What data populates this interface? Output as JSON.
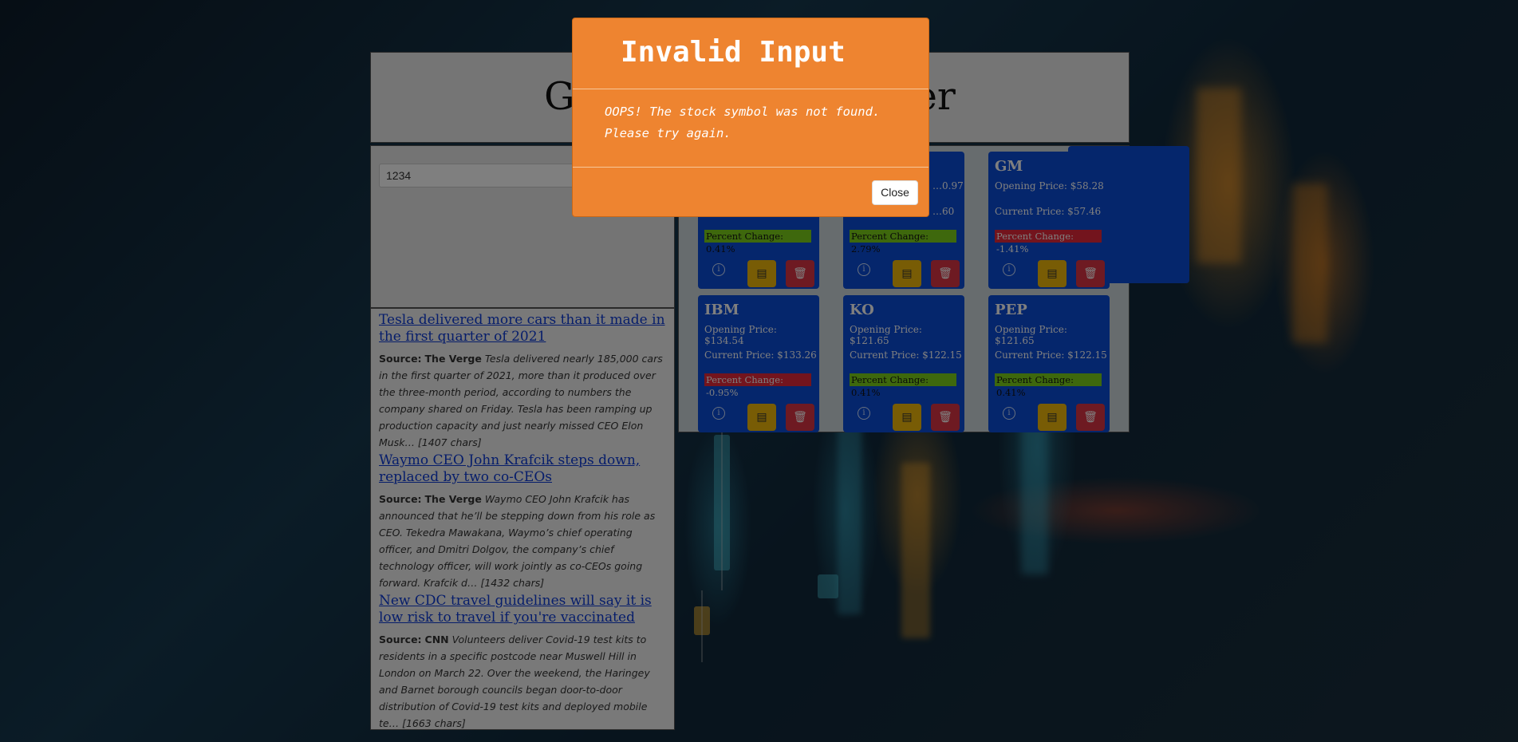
{
  "header": {
    "title": "Global Stock Tracker"
  },
  "search": {
    "value": "1234"
  },
  "news": [
    {
      "title": "Tesla delivered more cars than it made in the first quarter of 2021",
      "source_label": "Source:",
      "source": "The Verge",
      "text": "Tesla delivered nearly 185,000 cars in the first quarter of 2021, more than it produced over the three-month period, according to numbers the company shared on Friday. Tesla has been ramping up production capacity and just nearly missed CEO Elon Musk… [1407 chars]"
    },
    {
      "title": "Waymo CEO John Krafcik steps down, replaced by two co-CEOs",
      "source_label": "Source:",
      "source": "The Verge",
      "text": "Waymo CEO John Krafcik has announced that he’ll be stepping down from his role as CEO. Tekedra Mawakana, Waymo’s chief operating officer, and Dmitri Dolgov, the company’s chief technology officer, will work jointly as co-CEOs going forward. Krafcik d… [1432 chars]"
    },
    {
      "title": "New CDC travel guidelines will say it is low risk to travel if you're vaccinated",
      "source_label": "Source:",
      "source": "CNN",
      "text": "Volunteers deliver Covid-19 test kits to residents in a specific postcode near Muswell Hill in London on March 22. Over the weekend, the Haringey and Barnet borough councils began door-to-door distribution of Covid-19 test kits and deployed mobile te… [1663 chars]"
    }
  ],
  "cards": [
    {
      "symbol": "",
      "open": "",
      "current": "",
      "percent": "Percent Change: 0.41%",
      "trend": "up"
    },
    {
      "symbol": "",
      "open": "…0.97",
      "current": "…60",
      "percent": "Percent Change: 2.79%",
      "trend": "up"
    },
    {
      "symbol": "GM",
      "open": "Opening Price: $58.28",
      "current": "Current Price: $57.46",
      "percent": "Percent Change: -1.41%",
      "trend": "down"
    },
    {
      "symbol": "IBM",
      "open": "Opening Price: $134.54",
      "current": "Current Price: $133.26",
      "percent": "Percent Change: -0.95%",
      "trend": "down"
    },
    {
      "symbol": "KO",
      "open": "Opening Price: $121.65",
      "current": "Current Price: $122.15",
      "percent": "Percent Change: 0.41%",
      "trend": "up"
    },
    {
      "symbol": "PEP",
      "open": "Opening Price: $121.65",
      "current": "Current Price: $122.15",
      "percent": "Percent Change: 0.41%",
      "trend": "up"
    }
  ],
  "card_icons": {
    "info": "info-icon",
    "news": "newspaper-icon",
    "delete": "trash-icon"
  },
  "modal": {
    "title": "Invalid Input",
    "message": "OOPS! The stock symbol was not found. Please try again.",
    "close_label": "Close"
  },
  "colors": {
    "modal": "#ee8430",
    "card": "#0b4cd9",
    "up": "#7cd11b",
    "down": "#e6283a"
  }
}
